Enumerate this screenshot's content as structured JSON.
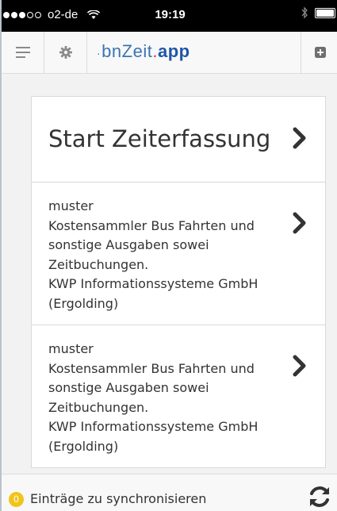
{
  "status_bar": {
    "carrier": "o2-de",
    "time": "19:19",
    "signal_bars_filled": 3,
    "signal_bars_total": 5
  },
  "nav": {
    "brand_prefix": "bn",
    "brand_zeit": "Zeit",
    "brand_dot": ".",
    "brand_app": "app",
    "icons": [
      "menu-icon",
      "gear-icon",
      "plus-square-icon"
    ]
  },
  "list": {
    "start_label": "Start Zeiterfassung",
    "entries": [
      {
        "lines": [
          "muster",
          "Kostensammler Bus Fahrten und",
          "sonstige Ausgaben sowei",
          "Zeitbuchungen.",
          "KWP Informationssysteme GmbH",
          "(Ergolding)"
        ]
      },
      {
        "lines": [
          "muster",
          "Kostensammler Bus Fahrten und",
          "sonstige Ausgaben sowei",
          "Zeitbuchungen.",
          "KWP Informationssysteme GmbH",
          "(Ergolding)"
        ]
      }
    ]
  },
  "footer": {
    "count": "0",
    "label": "Einträge zu synchronisieren"
  },
  "colors": {
    "brand_blue": "#3b74b5",
    "brand_dark_blue": "#1f55a8",
    "brand_red": "#e2332f",
    "badge_yellow": "#f0c419",
    "icon_gray": "#8a8a8a",
    "text_dark": "#333333"
  }
}
